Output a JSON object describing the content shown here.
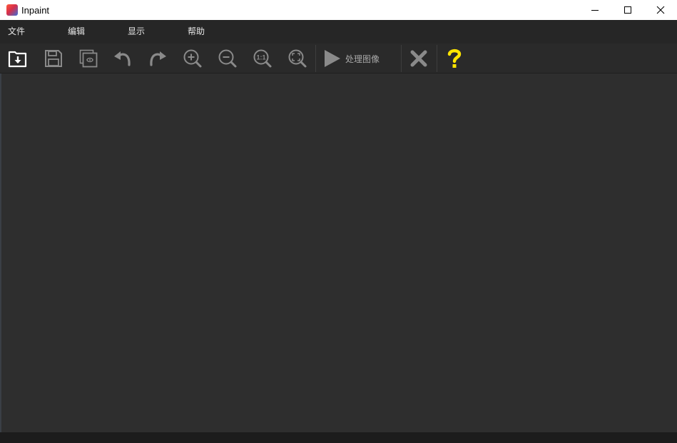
{
  "window": {
    "title": "Inpaint",
    "controls": [
      "minimize-icon",
      "maximize-icon",
      "close-icon"
    ]
  },
  "menu": {
    "items": [
      {
        "label": "文件"
      },
      {
        "label": "编辑"
      },
      {
        "label": "显示"
      },
      {
        "label": "帮助"
      }
    ]
  },
  "toolbar": {
    "buttons": [
      {
        "icon": "open-icon"
      },
      {
        "icon": "save-icon"
      },
      {
        "icon": "preview-icon"
      },
      {
        "icon": "undo-icon"
      },
      {
        "icon": "redo-icon"
      },
      {
        "icon": "zoom-in-icon"
      },
      {
        "icon": "zoom-out-icon"
      },
      {
        "icon": "actual-size-icon"
      },
      {
        "icon": "fit-screen-icon"
      }
    ],
    "process_label": "处理图像",
    "cancel_icon": "cancel-icon",
    "help_icon": "help-icon",
    "actual_size_text": "1:1"
  },
  "colors": {
    "background": "#2e2e2e",
    "menubar": "#262626",
    "toolbar": "#2a2a2a",
    "icon": "#8a8a8a",
    "icon_active": "#ffffff",
    "help": "#ffe500"
  }
}
